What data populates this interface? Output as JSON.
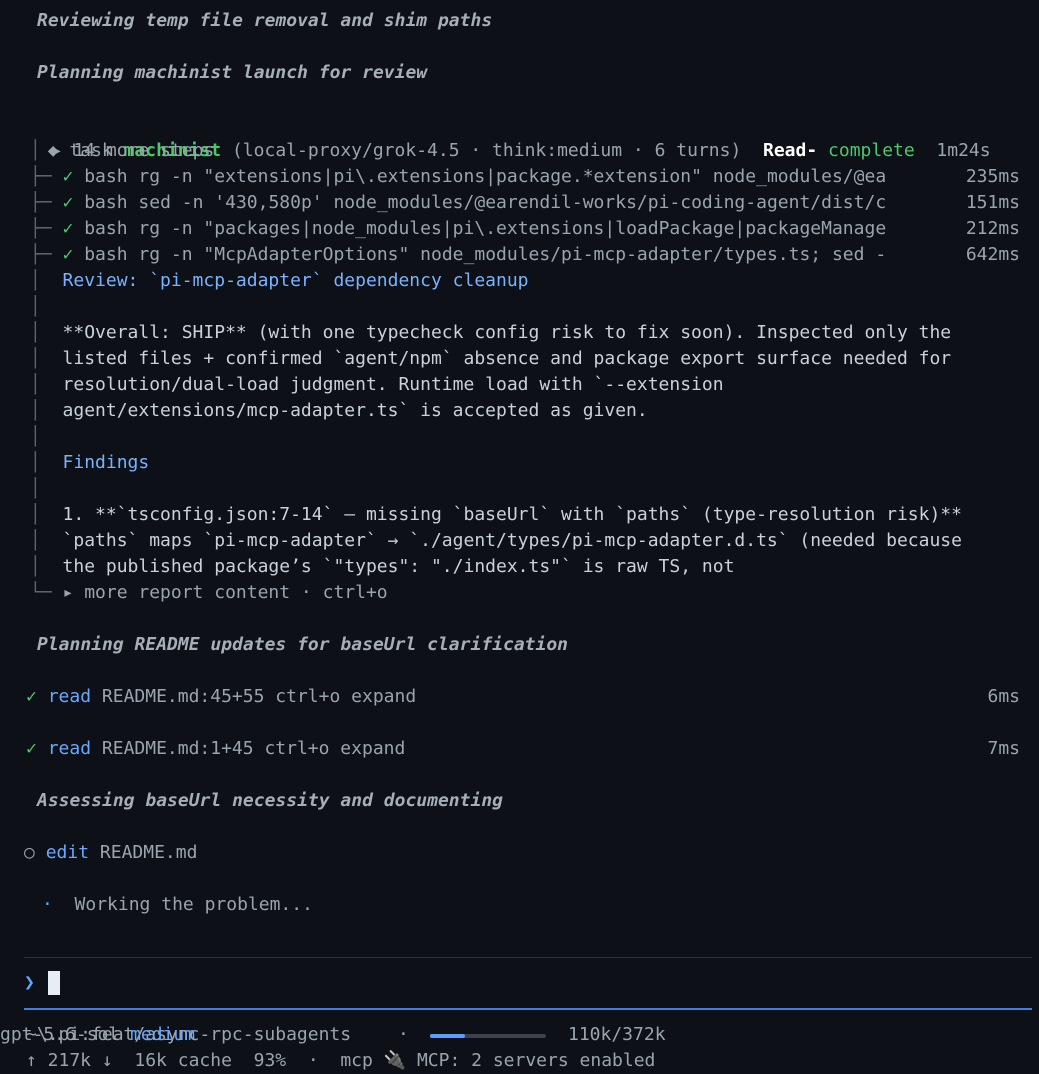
{
  "headings": {
    "h1": "Reviewing temp file removal and shim paths",
    "h2": "Planning machinist launch for review",
    "h3": "Planning README updates for baseUrl clarification",
    "h4": "Assessing baseUrl necessity and documenting"
  },
  "task": {
    "icon": "◆",
    "label": "task",
    "name": "machinist",
    "meta": "(local-proxy/grok-4.5 · think:medium · 6 turns)",
    "status_label": "Read-",
    "status": "complete",
    "time": "1m24s",
    "more_steps": "▸ 14 more steps",
    "steps": [
      {
        "check": "✓",
        "tool": "bash",
        "cmd": "rg -n \"extensions|pi\\.extensions|package.*extension\" node_modules/@ea",
        "time": "235ms"
      },
      {
        "check": "✓",
        "tool": "bash",
        "cmd": "sed -n '430,580p' node_modules/@earendil-works/pi-coding-agent/dist/c",
        "time": "151ms"
      },
      {
        "check": "✓",
        "tool": "bash",
        "cmd": "rg -n \"packages|node_modules|pi\\.extensions|loadPackage|packageManage",
        "time": "212ms"
      },
      {
        "check": "✓",
        "tool": "bash",
        "cmd": "rg -n \"McpAdapterOptions\" node_modules/pi-mcp-adapter/types.ts; sed -",
        "time": "642ms"
      }
    ],
    "report": {
      "title": "Review: `pi-mcp-adapter` dependency cleanup",
      "overall_1": "**Overall: SHIP** (with one typecheck config risk to fix soon). Inspected only the",
      "overall_2": "listed files + confirmed `agent/npm` absence and package export surface needed for",
      "overall_3": "resolution/dual-load judgment. Runtime load with `--extension",
      "overall_4": "agent/extensions/mcp-adapter.ts` is accepted as given.",
      "findings": "Findings",
      "f1_1": "1. **`tsconfig.json:7-14` — missing `baseUrl` with `paths` (type-resolution risk)**",
      "f1_2": "`paths` maps `pi-mcp-adapter` → `./agent/types/pi-mcp-adapter.d.ts` (needed because",
      "f1_3": "the published package’s `\"types\": \"./index.ts\"` is raw TS, not",
      "more": "▸ more report content · ctrl+o"
    }
  },
  "reads": [
    {
      "check": "✓",
      "tool": "read",
      "arg": "README.md:45+55",
      "hint": "ctrl+o expand",
      "time": "6ms"
    },
    {
      "check": "✓",
      "tool": "read",
      "arg": "README.md:1+45",
      "hint": "ctrl+o expand",
      "time": "7ms"
    }
  ],
  "edit": {
    "icon": "○",
    "tool": "edit",
    "arg": "README.md"
  },
  "working": {
    "dot": "·",
    "text": "Working the problem..."
  },
  "prompt": {
    "chevron": "❯"
  },
  "status_bar": {
    "path": "~\\.pi:feat/async-rpc-subagents",
    "sep": "·",
    "context": "110k/372k",
    "context_fraction": 0.3,
    "model": "gpt-5.6-sol",
    "effort": "medium",
    "line2": {
      "up": "↑ 217k",
      "down": "↓  16k",
      "cache": "cache  93%",
      "sep": "·",
      "mcp": "mcp",
      "plug": "🔌",
      "mcp_status": "MCP: 2 servers enabled"
    }
  },
  "colors": {
    "background": "#0d1117",
    "accent_green": "#4cc76a",
    "accent_blue": "#6aa8ff",
    "progress_fill": "#5b9cff"
  }
}
